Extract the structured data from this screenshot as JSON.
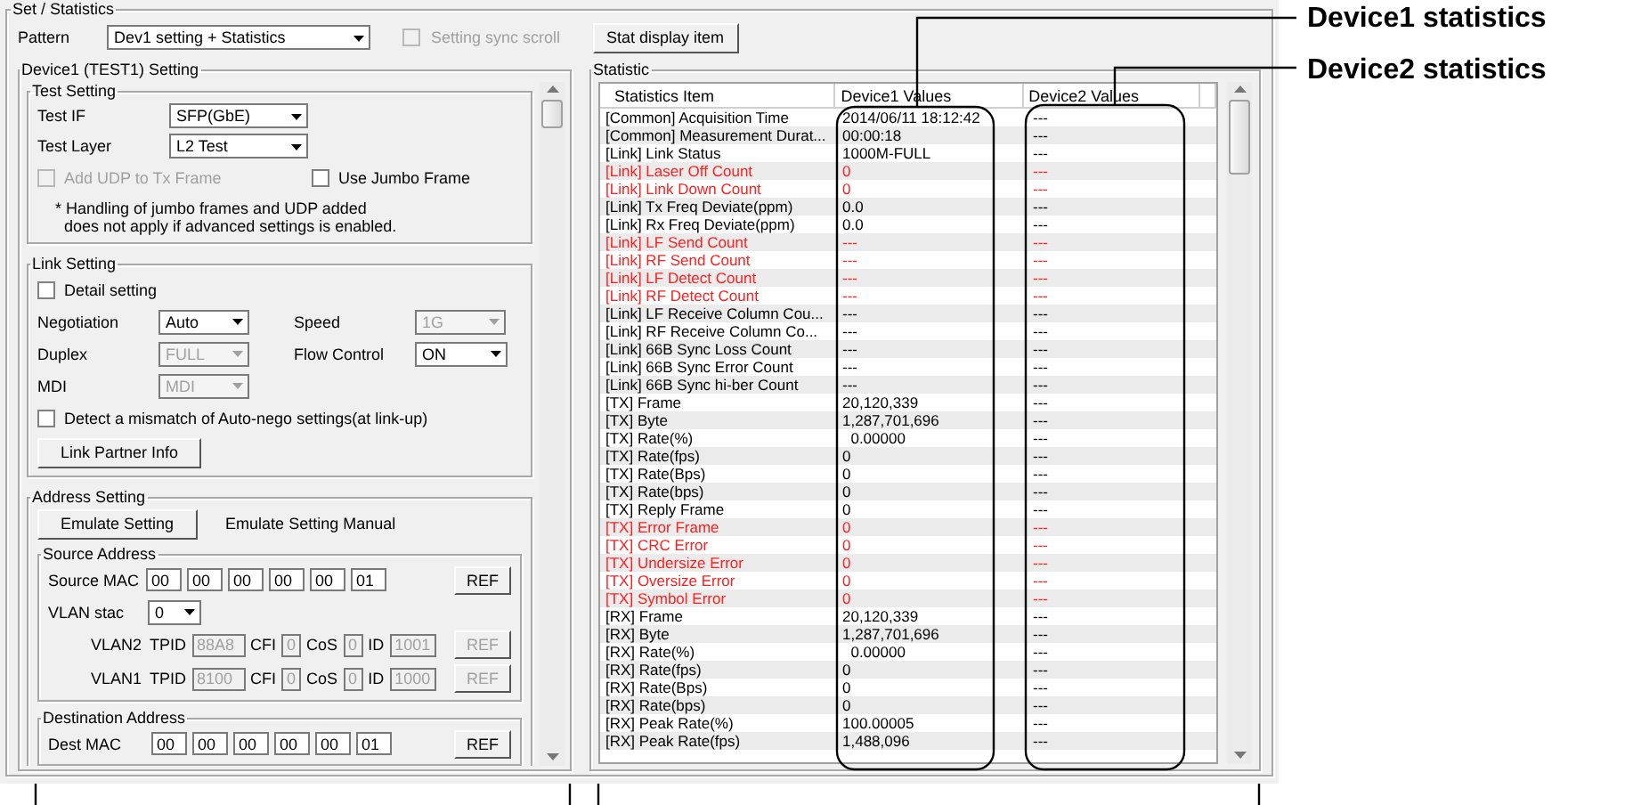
{
  "callouts": [
    {
      "label": "Device1 statistics"
    },
    {
      "label": "Device2 statistics"
    }
  ],
  "panel": {
    "title": "Set / Statistics"
  },
  "pattern": {
    "label": "Pattern",
    "value": "Dev1 setting + Statistics"
  },
  "sync_scroll": {
    "label": "Setting sync scroll",
    "checked": false,
    "disabled": true
  },
  "stat_display_button": "Stat display item",
  "device_setting": {
    "title": "Device1 (TEST1) Setting",
    "test_setting": {
      "title": "Test Setting",
      "fields": [
        {
          "label": "Test IF",
          "value": "SFP(GbE)"
        },
        {
          "label": "Test Layer",
          "value": "L2 Test"
        }
      ],
      "checkboxes": [
        {
          "label": "Add UDP to Tx Frame",
          "checked": false,
          "disabled": true
        },
        {
          "label": "Use Jumbo Frame",
          "checked": false,
          "disabled": false
        }
      ],
      "note": "* Handling of jumbo frames and UDP added\n  does not apply if advanced settings is enabled."
    },
    "link_setting": {
      "title": "Link Setting",
      "detail": {
        "label": "Detail setting",
        "checked": false
      },
      "fields": [
        {
          "label": "Negotiation",
          "value": "Auto",
          "disabled": false
        },
        {
          "label": "Speed",
          "value": "1G",
          "disabled": true
        },
        {
          "label": "Duplex",
          "value": "FULL",
          "disabled": true
        },
        {
          "label": "Flow Control",
          "value": "ON",
          "disabled": false
        },
        {
          "label": "MDI",
          "value": "MDI",
          "disabled": true
        }
      ],
      "mismatch": {
        "label": "Detect a mismatch of Auto-nego settings(at link-up)",
        "checked": false
      },
      "partner_button": "Link Partner Info"
    },
    "address_setting": {
      "title": "Address Setting",
      "emulate_button": "Emulate Setting",
      "emulate_label": "Emulate Setting Manual",
      "source": {
        "title": "Source Address",
        "mac_label": "Source MAC",
        "mac": [
          "00",
          "00",
          "00",
          "00",
          "00",
          "01"
        ],
        "ref": "REF",
        "vlan_stack": {
          "label": "VLAN stac",
          "value": "0"
        },
        "vlans": [
          {
            "name": "VLAN2",
            "disabled": true,
            "fields": [
              {
                "label": "TPID",
                "value": "88A8"
              },
              {
                "label": "CFI",
                "value": "0"
              },
              {
                "label": "CoS",
                "value": "0"
              },
              {
                "label": "ID",
                "value": "1001"
              }
            ],
            "ref": "REF"
          },
          {
            "name": "VLAN1",
            "disabled": true,
            "fields": [
              {
                "label": "TPID",
                "value": "8100"
              },
              {
                "label": "CFI",
                "value": "0"
              },
              {
                "label": "CoS",
                "value": "0"
              },
              {
                "label": "ID",
                "value": "1000"
              }
            ],
            "ref": "REF"
          }
        ]
      },
      "destination": {
        "title": "Destination Address",
        "mac_label": "Dest MAC",
        "mac": [
          "00",
          "00",
          "00",
          "00",
          "00",
          "01"
        ],
        "ref": "REF"
      }
    }
  },
  "statistic": {
    "title": "Statistic",
    "columns": [
      "Statistics Item",
      "Device1 Values",
      "Device2 Values"
    ],
    "rows": [
      {
        "item": "[Common] Acquisition Time",
        "device1": "2014/06/11 18:12:42",
        "device2": "---",
        "alarm": false
      },
      {
        "item": "[Common] Measurement Durat...",
        "device1": "00:00:18",
        "device2": "---",
        "alarm": false
      },
      {
        "item": "[Link] Link Status",
        "device1": "1000M-FULL",
        "device2": "---",
        "alarm": false
      },
      {
        "item": "[Link] Laser Off Count",
        "device1": "0",
        "device2": "---",
        "alarm": true
      },
      {
        "item": "[Link] Link Down Count",
        "device1": "0",
        "device2": "---",
        "alarm": true
      },
      {
        "item": "[Link] Tx Freq Deviate(ppm)",
        "device1": "0.0",
        "device2": "---",
        "alarm": false
      },
      {
        "item": "[Link] Rx Freq Deviate(ppm)",
        "device1": "0.0",
        "device2": "---",
        "alarm": false
      },
      {
        "item": "[Link] LF Send Count",
        "device1": "---",
        "device2": "---",
        "alarm": true
      },
      {
        "item": "[Link] RF Send Count",
        "device1": "---",
        "device2": "---",
        "alarm": true
      },
      {
        "item": "[Link] LF Detect Count",
        "device1": "---",
        "device2": "---",
        "alarm": true
      },
      {
        "item": "[Link] RF Detect Count",
        "device1": "---",
        "device2": "---",
        "alarm": true
      },
      {
        "item": "[Link] LF Receive Column Cou...",
        "device1": "---",
        "device2": "---",
        "alarm": false
      },
      {
        "item": "[Link] RF Receive Column Co...",
        "device1": "---",
        "device2": "---",
        "alarm": false
      },
      {
        "item": "[Link] 66B Sync Loss Count",
        "device1": "---",
        "device2": "---",
        "alarm": false
      },
      {
        "item": "[Link] 66B Sync Error Count",
        "device1": "---",
        "device2": "---",
        "alarm": false
      },
      {
        "item": "[Link] 66B Sync hi-ber Count",
        "device1": "---",
        "device2": "---",
        "alarm": false
      },
      {
        "item": "[TX] Frame",
        "device1": "20,120,339",
        "device2": "---",
        "alarm": false
      },
      {
        "item": "[TX] Byte",
        "device1": "1,287,701,696",
        "device2": "---",
        "alarm": false
      },
      {
        "item": "[TX] Rate(%)",
        "device1": "  0.00000",
        "device2": "---",
        "alarm": false
      },
      {
        "item": "[TX] Rate(fps)",
        "device1": "0",
        "device2": "---",
        "alarm": false
      },
      {
        "item": "[TX] Rate(Bps)",
        "device1": "0",
        "device2": "---",
        "alarm": false
      },
      {
        "item": "[TX] Rate(bps)",
        "device1": "0",
        "device2": "---",
        "alarm": false
      },
      {
        "item": "[TX] Reply Frame",
        "device1": "0",
        "device2": "---",
        "alarm": false
      },
      {
        "item": "[TX] Error Frame",
        "device1": "0",
        "device2": "---",
        "alarm": true
      },
      {
        "item": "[TX] CRC Error",
        "device1": "0",
        "device2": "---",
        "alarm": true
      },
      {
        "item": "[TX] Undersize Error",
        "device1": "0",
        "device2": "---",
        "alarm": true
      },
      {
        "item": "[TX] Oversize Error",
        "device1": "0",
        "device2": "---",
        "alarm": true
      },
      {
        "item": "[TX] Symbol Error",
        "device1": "0",
        "device2": "---",
        "alarm": true
      },
      {
        "item": "[RX] Frame",
        "device1": "20,120,339",
        "device2": "---",
        "alarm": false
      },
      {
        "item": "[RX] Byte",
        "device1": "1,287,701,696",
        "device2": "---",
        "alarm": false
      },
      {
        "item": "[RX] Rate(%)",
        "device1": "  0.00000",
        "device2": "---",
        "alarm": false
      },
      {
        "item": "[RX] Rate(fps)",
        "device1": "0",
        "device2": "---",
        "alarm": false
      },
      {
        "item": "[RX] Rate(Bps)",
        "device1": "0",
        "device2": "---",
        "alarm": false
      },
      {
        "item": "[RX] Rate(bps)",
        "device1": "0",
        "device2": "---",
        "alarm": false
      },
      {
        "item": "[RX] Peak Rate(%)",
        "device1": "100.00005",
        "device2": "---",
        "alarm": false
      },
      {
        "item": "[RX] Peak Rate(fps)",
        "device1": "1,488,096",
        "device2": "---",
        "alarm": false
      }
    ]
  }
}
